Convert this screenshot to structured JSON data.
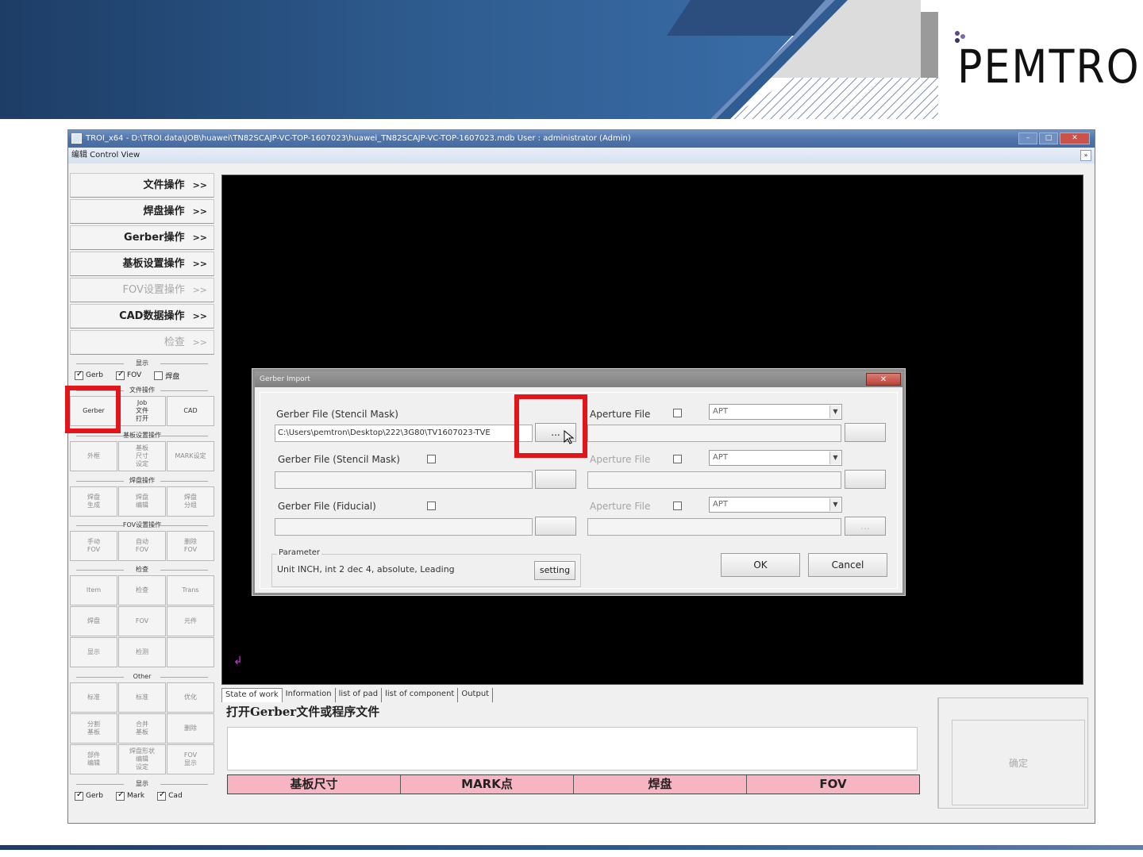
{
  "slide": {
    "logo_text": "PEMTRON",
    "colors": {
      "banner_dark": "#1d3d66",
      "banner_mid": "#2f5d91",
      "accent_red": "#e3151b",
      "pink": "#f7b4c3"
    }
  },
  "window": {
    "title": "TROI_x64 - D:\\TROI.data\\JOB\\huawei\\TN82SCAJP-VC-TOP-1607023\\huawei_TN82SCAJP-VC-TOP-1607023.mdb User : administrator (Admin)",
    "menu_label": "编辑 Control View",
    "pin_label": "»"
  },
  "left_nav": {
    "items": [
      {
        "label": "文件操作",
        "arrow": ">>"
      },
      {
        "label": "焊盘操作",
        "arrow": ">>"
      },
      {
        "label": "Gerber操作",
        "arrow": ">>"
      },
      {
        "label": "基板设置操作",
        "arrow": ">>"
      },
      {
        "label": "FOV设置操作",
        "arrow": ">>"
      },
      {
        "label": "CAD数据操作",
        "arrow": ">>"
      },
      {
        "label": "检查",
        "arrow": ">>"
      }
    ],
    "display_group": "显示",
    "display_checks": [
      {
        "label": "Gerb",
        "checked": true
      },
      {
        "label": "FOV",
        "checked": true
      },
      {
        "label": "焊盘",
        "checked": false
      }
    ],
    "file_group": "文件操作",
    "file_buttons": [
      "Gerber",
      "Job\n文件\n打开",
      "CAD"
    ],
    "board_group": "基板设置操作",
    "board_buttons": [
      "外框",
      "基板\n尺寸\n设定",
      "MARK设定"
    ],
    "pad_group": "焊盘操作",
    "pad_buttons": [
      "焊盘\n生成",
      "焊盘\n编辑",
      "焊盘\n分组"
    ],
    "fov_group": "FOV设置操作",
    "fov_buttons": [
      "手动\nFOV",
      "自动\nFOV",
      "删除\nFOV"
    ],
    "check_group": "检查",
    "check_buttons": [
      "Item",
      "检查",
      "Trans",
      "焊盘",
      "FOV",
      "元件",
      "显示",
      "检测",
      ""
    ],
    "other_group": "Other",
    "other_buttons": [
      "标准",
      "标准",
      "优化",
      "分割\n基板",
      "合并\n基板",
      "删除",
      "部件\n编辑",
      "焊盘形状\n编辑\n设定",
      "FOV\n显示"
    ],
    "show_group": "显示",
    "show_checks": [
      {
        "label": "Gerb",
        "checked": true
      },
      {
        "label": "Mark",
        "checked": true
      },
      {
        "label": "Cad",
        "checked": true
      }
    ]
  },
  "dialog": {
    "title": "Gerber Import",
    "close_label": "✕",
    "gerber_mask_label": "Gerber File (Stencil Mask)",
    "gerber_mask_value": "C:\\Users\\pemtron\\Desktop\\222\\3G80\\TV1607023-TVE",
    "browse_label": "...",
    "aperture_label": "Aperture File",
    "gerber_mask2_label": "Gerber File (Stencil Mask)",
    "aperture2_label": "Aperture File",
    "gerber_fiducial_label": "Gerber File (Fiducial)",
    "aperture3_label": "Aperture File",
    "apt_value": "APT",
    "dropdown_glyph": "▼",
    "param_legend": "Parameter",
    "param_value": "Unit INCH, int 2 dec 4, absolute, Leading",
    "setting_label": "setting",
    "ok_label": "OK",
    "cancel_label": "Cancel"
  },
  "bottom": {
    "tabs": [
      "State of work",
      "Information",
      "list of pad",
      "list of component",
      "Output"
    ],
    "status_text": "打开Gerber文件或程序文件",
    "pink_labels": [
      "基板尺寸",
      "MARK点",
      "焊盘",
      "FOV"
    ],
    "confirm_label": "确定"
  }
}
